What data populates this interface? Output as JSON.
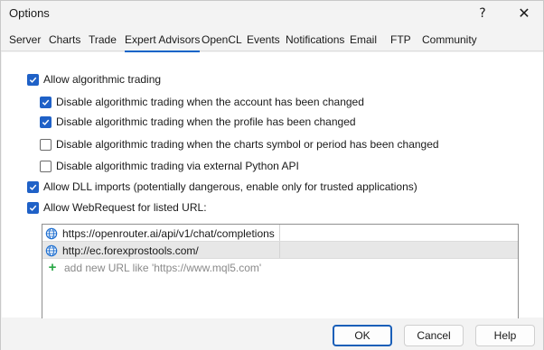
{
  "window": {
    "title": "Options",
    "help_glyph": "?",
    "close_glyph": "✕"
  },
  "tabs": [
    {
      "label": "Server"
    },
    {
      "label": "Charts"
    },
    {
      "label": "Trade"
    },
    {
      "label": "Expert Advisors",
      "active": true
    },
    {
      "label": "OpenCL"
    },
    {
      "label": "Events"
    },
    {
      "label": "Notifications"
    },
    {
      "label": "Email"
    },
    {
      "label": "FTP"
    },
    {
      "label": "Community"
    }
  ],
  "options": [
    {
      "label": "Allow algorithmic trading",
      "checked": true
    },
    {
      "label": "Disable algorithmic trading when the account has been changed",
      "checked": true
    },
    {
      "label": "Disable algorithmic trading when the profile has been changed",
      "checked": true
    },
    {
      "label": "Disable algorithmic trading when the charts symbol or period has been changed",
      "checked": false
    },
    {
      "label": "Disable algorithmic trading via external Python API",
      "checked": false
    },
    {
      "label": "Allow DLL imports (potentially dangerous, enable only for trusted applications)",
      "checked": true
    },
    {
      "label": "Allow WebRequest for listed URL:",
      "checked": true
    }
  ],
  "url_list": {
    "urls": [
      {
        "url": "https://openrouter.ai/api/v1/chat/completions",
        "selected": false
      },
      {
        "url": "http://ec.forexprostools.com/",
        "selected": true
      }
    ],
    "add_placeholder": "add new URL like 'https://www.mql5.com'"
  },
  "footer": {
    "ok_label": "OK",
    "cancel_label": "Cancel",
    "help_label": "Help"
  },
  "colors": {
    "checkbox_checked": "#1f61c7",
    "active_tab_underline": "#0a64c8",
    "add_icon": "#28a745",
    "selected_row": "#e7e7e7"
  }
}
